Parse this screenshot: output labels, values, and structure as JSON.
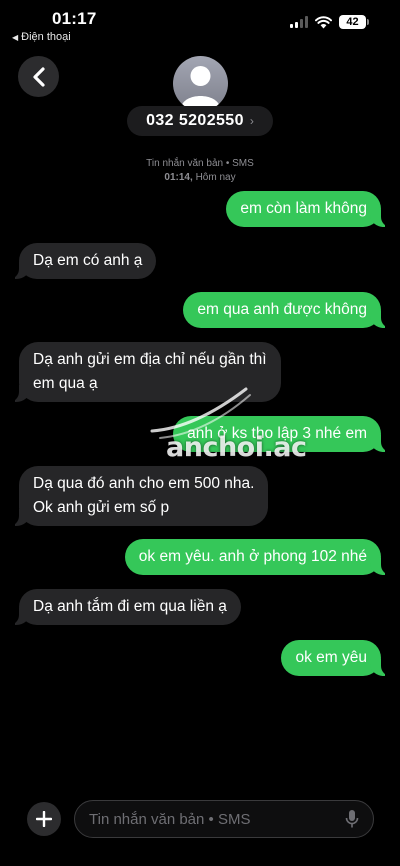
{
  "status_bar": {
    "time": "01:17",
    "back_app": "Điện thoại",
    "battery": "42"
  },
  "header": {
    "contact_number": "032 5202550",
    "chevron": "›"
  },
  "thread": {
    "service": "Tin nhắn văn bản • SMS",
    "timestamp_time": "01:14,",
    "timestamp_day": "Hôm nay"
  },
  "messages": [
    {
      "direction": "out",
      "text": "em còn làm không"
    },
    {
      "direction": "in",
      "text": "Dạ em có anh ạ"
    },
    {
      "direction": "out",
      "text": "em qua anh được không"
    },
    {
      "direction": "in",
      "lines": [
        "Dạ anh gửi em địa chỉ nếu gần thì",
        "em qua ạ"
      ]
    },
    {
      "direction": "out",
      "text": "anh ở ks tho lập 3 nhé em"
    },
    {
      "direction": "in",
      "lines": [
        "Dạ qua đó anh cho em 500 nha.",
        "Ok anh gửi em số p"
      ]
    },
    {
      "direction": "out",
      "text": "ok em yêu. anh ở phong 102 nhé"
    },
    {
      "direction": "in",
      "text": "Dạ anh tắm đi em qua liền ạ"
    },
    {
      "direction": "out",
      "text": "ok em yêu"
    }
  ],
  "watermark": "anchoi.ac",
  "composer": {
    "placeholder": "Tin nhắn văn bản • SMS"
  },
  "colors": {
    "outgoing_bubble": "#35c759",
    "incoming_bubble": "#262628",
    "background": "#000000"
  },
  "icons": [
    "back-chevron-icon",
    "person-icon",
    "plus-icon",
    "microphone-icon",
    "signal-icon",
    "wifi-icon",
    "battery-icon"
  ]
}
